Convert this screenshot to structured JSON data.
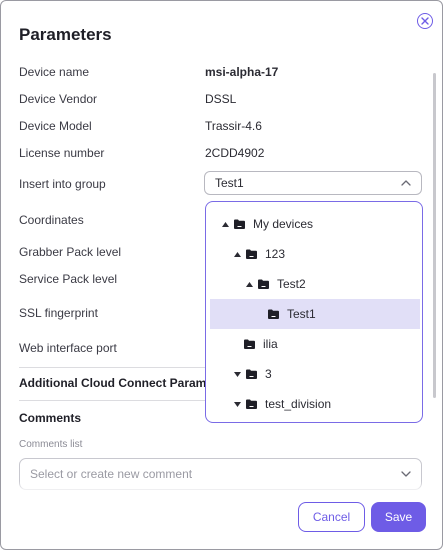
{
  "dialog": {
    "title": "Parameters",
    "close_icon": "close-circle-icon"
  },
  "fields": [
    {
      "label": "Device name",
      "value": "msi-alpha-17"
    },
    {
      "label": "Device Vendor",
      "value": "DSSL"
    },
    {
      "label": "Device Model",
      "value": "Trassir-4.6"
    },
    {
      "label": "License number",
      "value": "2CDD4902"
    }
  ],
  "group": {
    "label": "Insert into group",
    "selected": "Test1",
    "expanded": true
  },
  "other_labels": {
    "coordinates": "Coordinates",
    "grabber_pack": "Grabber Pack level",
    "service_pack": "Service Pack level",
    "ssl_fingerprint": "SSL fingerprint",
    "web_port": "Web interface port"
  },
  "tree": [
    {
      "label": "My devices",
      "level": 0,
      "caret": "up"
    },
    {
      "label": "123",
      "level": 1,
      "caret": "up"
    },
    {
      "label": "Test2",
      "level": 2,
      "caret": "up"
    },
    {
      "label": "Test1",
      "level": 3,
      "caret": "none",
      "selected": true
    },
    {
      "label": "ilia",
      "level": 1,
      "caret": "none"
    },
    {
      "label": "3",
      "level": 1,
      "caret": "down"
    },
    {
      "label": "test_division",
      "level": 1,
      "caret": "down"
    }
  ],
  "sections": {
    "cloud_connect": "Additional Cloud Connect Parameters",
    "comments": "Comments",
    "comments_list_label": "Comments list",
    "comments_placeholder": "Select or create new comment"
  },
  "buttons": {
    "cancel": "Cancel",
    "save": "Save"
  },
  "colors": {
    "accent": "#6e5ce6",
    "selected_row": "#e1dff7"
  }
}
